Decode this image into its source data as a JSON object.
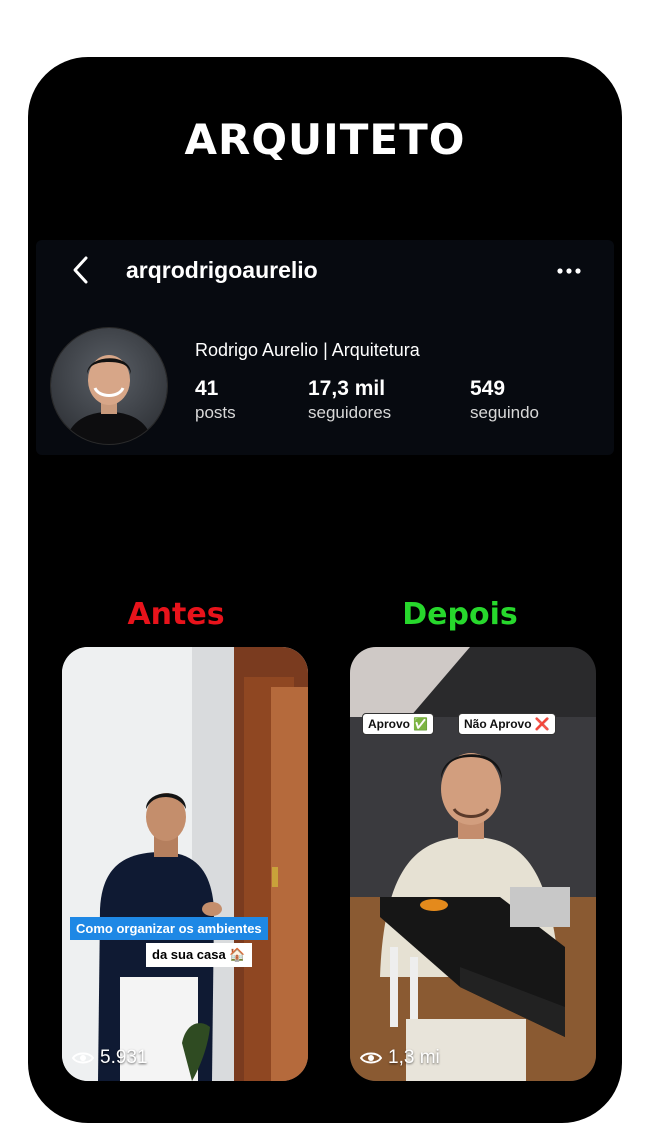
{
  "headline": "ARQUITETO",
  "profile": {
    "username": "arqrodrigoaurelio",
    "full_name": "Rodrigo Aurelio | Arquitetura",
    "stats": [
      {
        "value": "41",
        "label": "posts"
      },
      {
        "value": "17,3 mil",
        "label": "seguidores"
      },
      {
        "value": "549",
        "label": "seguindo"
      }
    ]
  },
  "comparison": {
    "before": {
      "label": "Antes",
      "label_color": "#e8131b",
      "caption_line1": "Como organizar os ambientes",
      "caption_line2": "da sua casa",
      "caption_emoji": "🏠",
      "views": "5.931"
    },
    "after": {
      "label": "Depois",
      "label_color": "#27d82c",
      "tag_approve": "Aprovo",
      "tag_approve_emoji": "✅",
      "tag_reject": "Não Aprovo",
      "tag_reject_emoji": "❌",
      "views": "1,3 mi"
    }
  },
  "icons": {
    "back": "chevron-left-icon",
    "more": "more-horizontal-icon",
    "views": "eye-icon"
  }
}
